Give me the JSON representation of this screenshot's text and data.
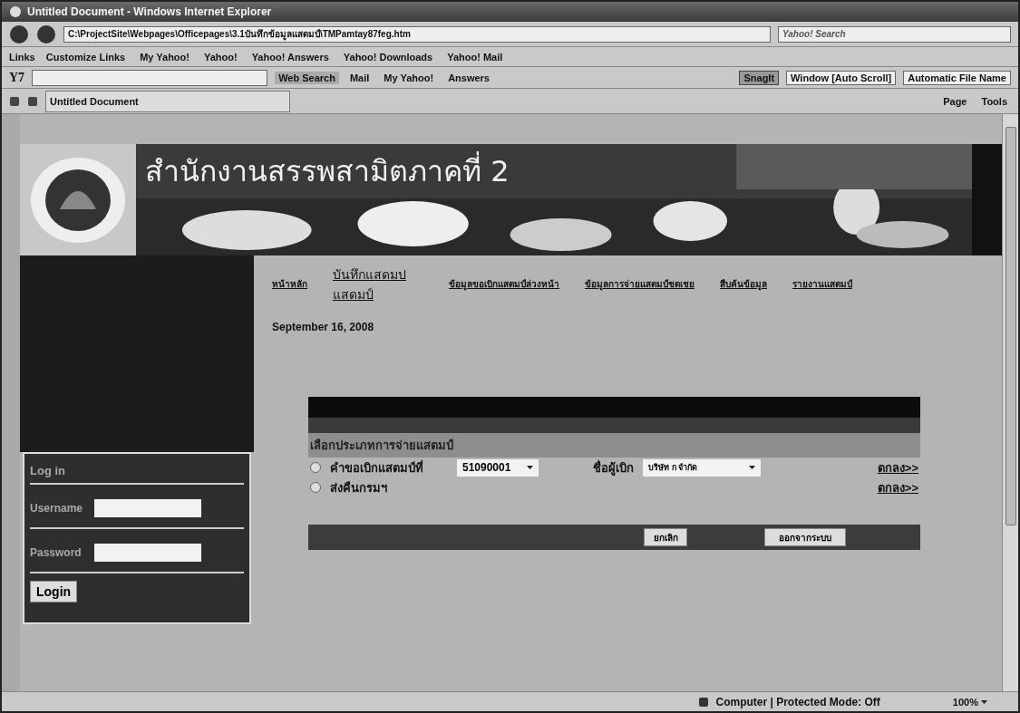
{
  "window": {
    "title": "Untitled Document - Windows Internet Explorer"
  },
  "address_bar": {
    "url": "C:\\ProjectSite\\Webpages\\Officepages\\3.1บันทึกข้อมูลแสดมป์\\TMPamtay87feg.htm"
  },
  "search": {
    "placeholder": "Yahoo! Search"
  },
  "links_bar": {
    "label": "Links",
    "items": [
      "Customize Links",
      "My Yahoo!",
      "Yahoo!",
      "Yahoo! Answers",
      "Yahoo! Downloads",
      "Yahoo! Mail"
    ]
  },
  "yahoo_toolbar": {
    "logo": "Y7",
    "search_button": "Web Search",
    "items": [
      "Mail",
      "My Yahoo!",
      "Answers"
    ],
    "snagit": "SnagIt",
    "dropdowns": [
      "Window [Auto Scroll]",
      "Automatic File Name"
    ]
  },
  "tab": {
    "label": "Untitled Document"
  },
  "command_bar": [
    "Page",
    "Tools"
  ],
  "page": {
    "header_title": "สำนักงานสรรพสามิตภาคที่ 2",
    "nav": [
      {
        "label": "หน้าหลัก",
        "large": false
      },
      {
        "label": "บันทึกแสดมป แสดมป์",
        "large": true
      },
      {
        "label": "ข้อมูลขอเบิกแสตมป์ล่วงหน้า",
        "large": false
      },
      {
        "label": "ข้อมูลการจ่ายแสตมป์ชดเชย",
        "large": false
      },
      {
        "label": "สืบค้นข้อมูล",
        "large": false
      },
      {
        "label": "รายงานแสตมป์",
        "large": false
      }
    ],
    "date": "September 16, 2008",
    "form": {
      "heading": "เลือกประเภทการจ่ายแสตมป์",
      "options": [
        {
          "label": "คำขอเบิกแสตมป์ที่",
          "selected": false,
          "request_no": "51090001",
          "requester_label": "ชื่อผู้เบิก",
          "requester": "บริษัท ก จำกัด",
          "ok": "ตกลง>>"
        },
        {
          "label": "ส่งคืนกรมฯ",
          "selected": false,
          "ok": "ตกลง>>"
        }
      ],
      "buttons": [
        "ยกเลิก",
        "ออกจากระบบ"
      ]
    },
    "login": {
      "title": "Log in",
      "fields": [
        "Username",
        "Password"
      ],
      "button": "Login"
    }
  },
  "status_bar": {
    "zone": "Computer | Protected Mode: Off",
    "zoom": "100%"
  }
}
